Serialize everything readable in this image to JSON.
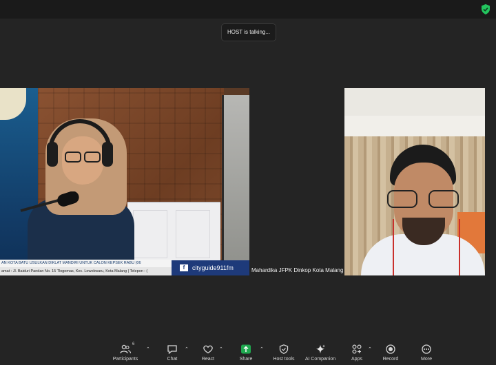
{
  "header": {
    "status_pill": "HOST is talking..."
  },
  "left_video": {
    "ticker_top": "AN KOTA BATU USULKAN DIKLAT MANDIRI UNTUK CALON KEPSEK    RABU (06",
    "ticker_bottom": "amat : Jl. Baiduri Pandan No. 15 Tlogomas, Kec. Lowokwaru, Kota Malang | Telepon : (",
    "social_handle": "cityguide911fm",
    "social_icon": "f"
  },
  "middle_tile": {
    "participant_name": "Mahardika JFPK Dinkop Kota Malang"
  },
  "toolbar": {
    "participants_label": "Participants",
    "participants_count": "6",
    "chat_label": "Chat",
    "react_label": "React",
    "share_label": "Share",
    "host_tools_label": "Host tools",
    "ai_label": "AI Companion",
    "apps_label": "Apps",
    "record_label": "Record",
    "more_label": "More"
  },
  "colors": {
    "background": "#242424",
    "share_green": "#1fa84f",
    "security_green": "#23c55e",
    "cityguide_blue": "#1e3a7a"
  },
  "icons": {
    "security": "shield-check-icon",
    "participants": "people-icon",
    "chat": "chat-bubble-icon",
    "react": "heart-icon",
    "share": "share-arrow-icon",
    "host_tools": "shield-icon",
    "ai": "sparkle-icon",
    "apps": "apps-icon",
    "record": "record-icon",
    "more": "ellipsis-icon"
  }
}
